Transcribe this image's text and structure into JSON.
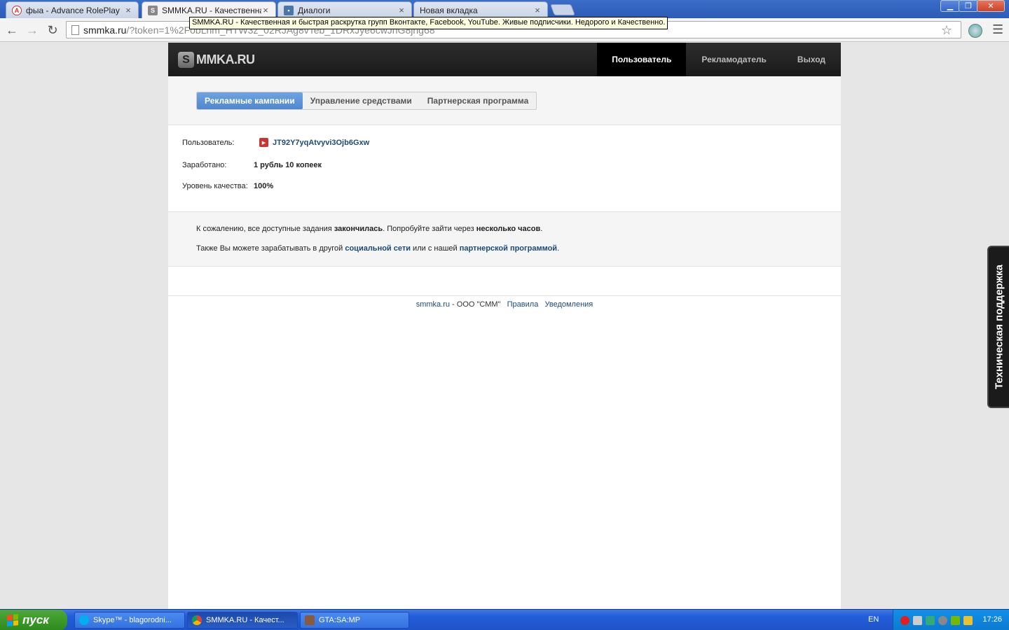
{
  "browser": {
    "tabs": [
      {
        "label": "фыа - Advance RolePlay",
        "active": false
      },
      {
        "label": "SMMKA.RU - Качественная",
        "active": true
      },
      {
        "label": "Диалоги",
        "active": false
      },
      {
        "label": "Новая вкладка",
        "active": false
      }
    ],
    "url_host": "smmka.ru",
    "url_path": "/?token=1%2FobLhm_HTW3z_02RJAg8vTeb_1DRxJye6cwJhG8jhg68",
    "tooltip": "SMMKA.RU - Качественная и быстрая раскрутка групп Вконтакте, Facebook, YouTube. Живые подписчики. Недорого и Качественно."
  },
  "site": {
    "logo_mark": "S",
    "logo_text": "MMKA.RU",
    "nav": {
      "user": "Пользователь",
      "advertiser": "Рекламодатель",
      "logout": "Выход"
    },
    "subtabs": {
      "campaigns": "Рекламные кампании",
      "funds": "Управление средствами",
      "partner": "Партнерская программа"
    },
    "info": {
      "user_label": "Пользователь:",
      "user_value": "JT92Y7yqAtvyvi3Ojb6Gxw",
      "earned_label": "Заработано:",
      "earned_value": "1 рубль 10 копеек",
      "quality_label": "Уровень качества:",
      "quality_value": "100%"
    },
    "notice": {
      "line1_a": "К сожалению, все доступные задания ",
      "line1_b": "закончилась",
      "line1_c": ". Попробуйте зайти через ",
      "line1_d": "несколько часов",
      "line1_e": ".",
      "line2_a": "Также Вы можете зарабатывать в другой ",
      "line2_link1": "социальной сети",
      "line2_b": " или с нашей ",
      "line2_link2": "партнерской программой",
      "line2_c": "."
    },
    "footer": {
      "site": "smmka.ru",
      "company": " - ООО \"СММ\"",
      "rules": "Правила",
      "notifications": "Уведомления"
    },
    "support": "Техническая поддержка"
  },
  "taskbar": {
    "start": "пуск",
    "items": [
      {
        "label": "Skype™ - blagorodni..."
      },
      {
        "label": "SMMKA.RU - Качест..."
      },
      {
        "label": "GTA:SA:MP"
      }
    ],
    "lang": "EN",
    "clock": "17:26"
  }
}
